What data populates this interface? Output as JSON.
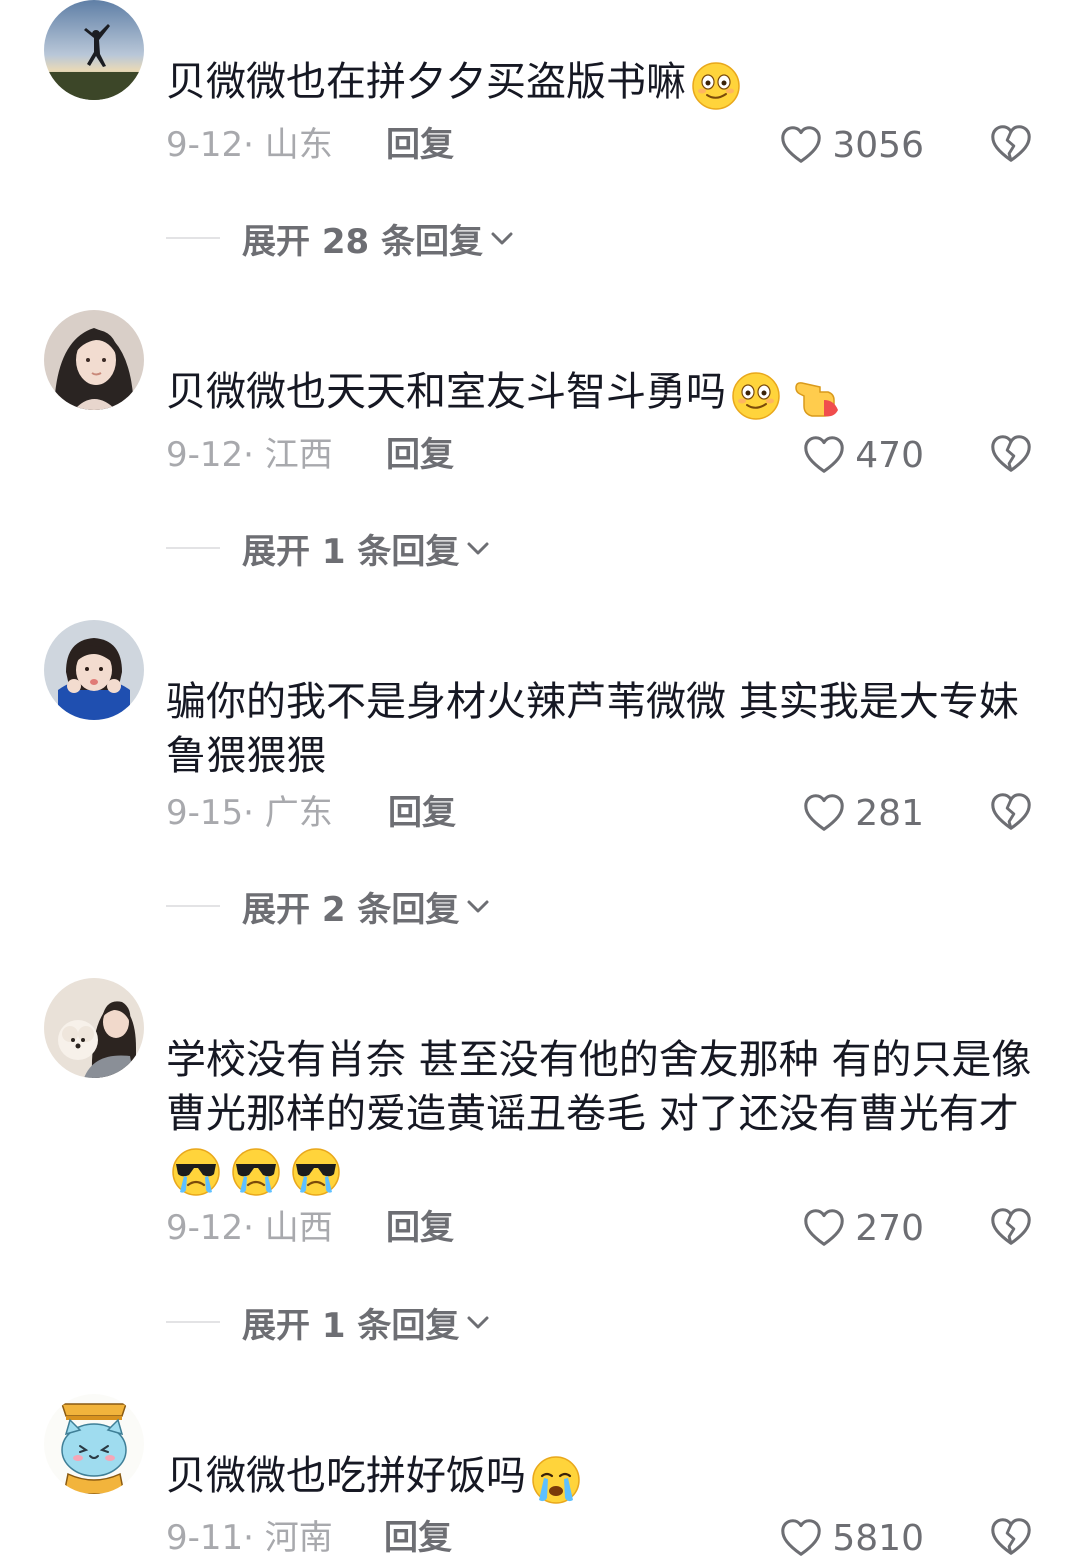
{
  "comments": [
    {
      "avatar": "silhouette-jump-avatar",
      "text": "贝微微也在拼夕夕买盗版书嘛",
      "emojis": [
        "smirk-face"
      ],
      "date": "9-12",
      "location": "山东",
      "reply_label": "回复",
      "likes": "3056",
      "expand_label": "展开 28 条回复"
    },
    {
      "avatar": "girl-portrait-avatar",
      "text": "贝微微也天天和室友斗智斗勇吗",
      "emojis": [
        "smirk-face",
        "pointing-hand"
      ],
      "date": "9-12",
      "location": "江西",
      "reply_label": "回复",
      "likes": "470",
      "expand_label": "展开 1 条回复"
    },
    {
      "avatar": "girl-blue-jacket-avatar",
      "text": "骗你的我不是身材火辣芦苇微微 其实我是大专妹鲁猥猥猥",
      "emojis": [],
      "date": "9-15",
      "location": "广东",
      "reply_label": "回复",
      "likes": "281",
      "expand_label": "展开 2 条回复"
    },
    {
      "avatar": "girl-with-dog-avatar",
      "text": "学校没有肖奈 甚至没有他的舍友那种 有的只是像曹光那样的爱造黄谣丑卷毛  对了还没有曹光有才",
      "emojis": [
        "cool-crying-face",
        "cool-crying-face",
        "cool-crying-face"
      ],
      "date": "9-12",
      "location": "山西",
      "reply_label": "回复",
      "likes": "270",
      "expand_label": "展开 1 条回复"
    },
    {
      "avatar": "cartoon-cat-avatar",
      "text": "贝微微也吃拼好饭吗",
      "emojis": [
        "crying-face"
      ],
      "date": "9-11",
      "location": "河南",
      "reply_label": "回复",
      "likes": "5810",
      "expand_label": ""
    }
  ],
  "colors": {
    "text": "#161823",
    "meta": "#a8a9ad",
    "action": "#6d6e73",
    "divider": "#e3e3e5"
  }
}
